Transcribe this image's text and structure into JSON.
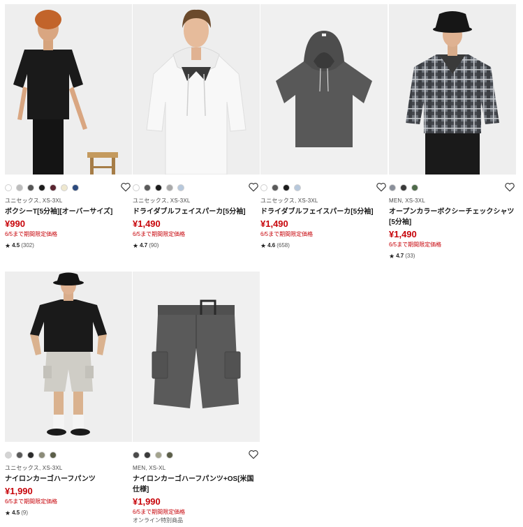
{
  "products": [
    {
      "gender_size": "ユニセックス, XS-3XL",
      "name": "ボクシーT[5分袖][オーバーサイズ]",
      "price": "¥990",
      "promo": "6/5まで期間限定価格",
      "rating": "4.5",
      "reviews": "(302)",
      "colors": [
        "#ffffff",
        "#bdbdbd",
        "#555555",
        "#1c1c1c",
        "#5a2430",
        "#efe8cf",
        "#2c4a7e"
      ],
      "image": "man-black-tee"
    },
    {
      "gender_size": "ユニセックス, XS-3XL",
      "name": "ドライダブルフェイスパーカ[5分袖]",
      "price": "¥1,490",
      "promo": "6/5まで期間限定価格",
      "rating": "4.7",
      "reviews": "(90)",
      "colors": [
        "#ffffff",
        "#5a5a5a",
        "#1c1c1c",
        "#a9a9a9",
        "#b7c8dc"
      ],
      "image": "man-white-hoodie"
    },
    {
      "gender_size": "ユニセックス, XS-3XL",
      "name": "ドライダブルフェイスパーカ[5分袖]",
      "price": "¥1,490",
      "promo": "6/5まで期間限定価格",
      "rating": "4.6",
      "reviews": "(658)",
      "colors": [
        "#ffffff",
        "#5a5a5a",
        "#1c1c1c",
        "#b7c8dc"
      ],
      "image": "gray-hoodie-flat"
    },
    {
      "gender_size": "MEN, XS-3XL",
      "name": "オープンカラーボクシーチェックシャツ[5分袖]",
      "price": "¥1,490",
      "promo": "6/5まで期間限定価格",
      "rating": "4.7",
      "reviews": "(33)",
      "colors": [
        "#8a8f9a",
        "#3a3a3a",
        "#4f6b4a"
      ],
      "image": "man-check-shirt"
    },
    {
      "gender_size": "ユニセックス, XS-3XL",
      "name": "ナイロンカーゴハーフパンツ",
      "price": "¥1,990",
      "promo": "6/5まで期間限定価格",
      "rating": "4.5",
      "reviews": "(9)",
      "colors": [
        "#d4d4d4",
        "#5a5a5a",
        "#2a2a2a",
        "#8b8b78",
        "#5b5e48"
      ],
      "image": "man-cargo-shorts"
    },
    {
      "gender_size": "MEN, XS-XL",
      "name": "ナイロンカーゴハーフパンツ+OS[米国仕様]",
      "price": "¥1,990",
      "promo": "6/5まで期間限定価格",
      "online": "オンライン特別商品",
      "colors": [
        "#4a4a4a",
        "#3a3a3a",
        "#a3a38d",
        "#5b5e48"
      ],
      "image": "gray-cargo-shorts-flat"
    }
  ],
  "icons": {
    "favorite": "heart-outline-icon",
    "star": "star-icon"
  }
}
